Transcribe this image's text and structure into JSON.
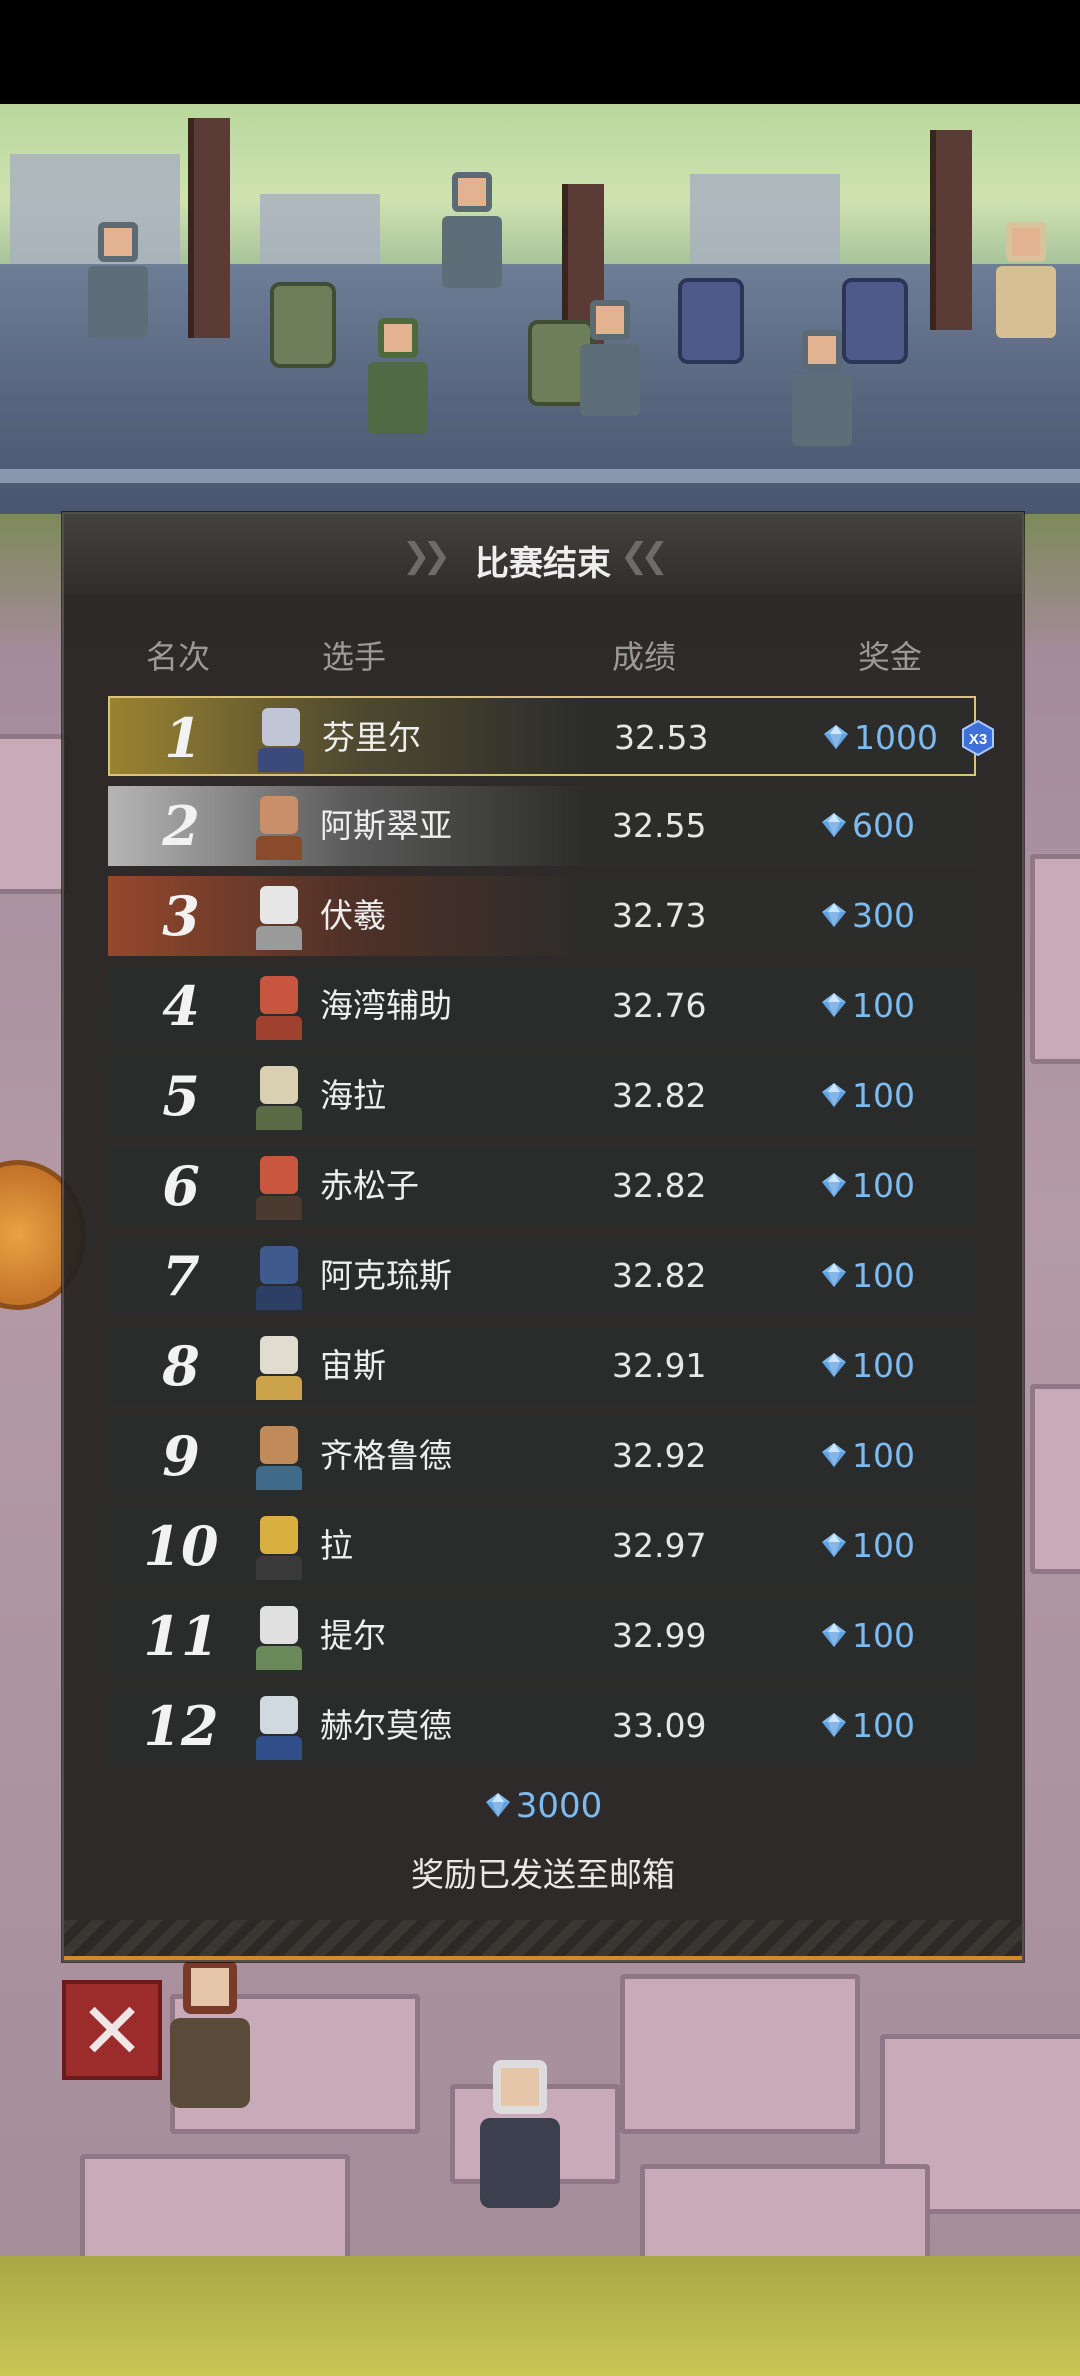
{
  "panel": {
    "title": "比赛结束",
    "columns": {
      "rank": "名次",
      "player": "选手",
      "score": "成绩",
      "prize": "奖金"
    },
    "rows": [
      {
        "rank": "1",
        "name": "芬里尔",
        "score": "32.53",
        "prize": "1000",
        "multiplier": "X3"
      },
      {
        "rank": "2",
        "name": "阿斯翠亚",
        "score": "32.55",
        "prize": "600"
      },
      {
        "rank": "3",
        "name": "伏羲",
        "score": "32.73",
        "prize": "300"
      },
      {
        "rank": "4",
        "name": "海湾辅助",
        "score": "32.76",
        "prize": "100"
      },
      {
        "rank": "5",
        "name": "海拉",
        "score": "32.82",
        "prize": "100"
      },
      {
        "rank": "6",
        "name": "赤松子",
        "score": "32.82",
        "prize": "100"
      },
      {
        "rank": "7",
        "name": "阿克琉斯",
        "score": "32.82",
        "prize": "100"
      },
      {
        "rank": "8",
        "name": "宙斯",
        "score": "32.91",
        "prize": "100"
      },
      {
        "rank": "9",
        "name": "齐格鲁德",
        "score": "32.92",
        "prize": "100"
      },
      {
        "rank": "10",
        "name": "拉",
        "score": "32.97",
        "prize": "100"
      },
      {
        "rank": "11",
        "name": "提尔",
        "score": "32.99",
        "prize": "100"
      },
      {
        "rank": "12",
        "name": "赫尔莫德",
        "score": "33.09",
        "prize": "100"
      }
    ],
    "total": "3000",
    "note": "奖励已发送至邮箱"
  },
  "icons": {
    "currency": "diamond-gem-icon",
    "close": "close-x-icon"
  },
  "colors": {
    "gold": "#d9c27a",
    "silver": "#b5b5b5",
    "bronze": "#94482c",
    "currency": "#7dbaf0",
    "close": "#9c2b2b",
    "accent": "#d28a2b"
  }
}
